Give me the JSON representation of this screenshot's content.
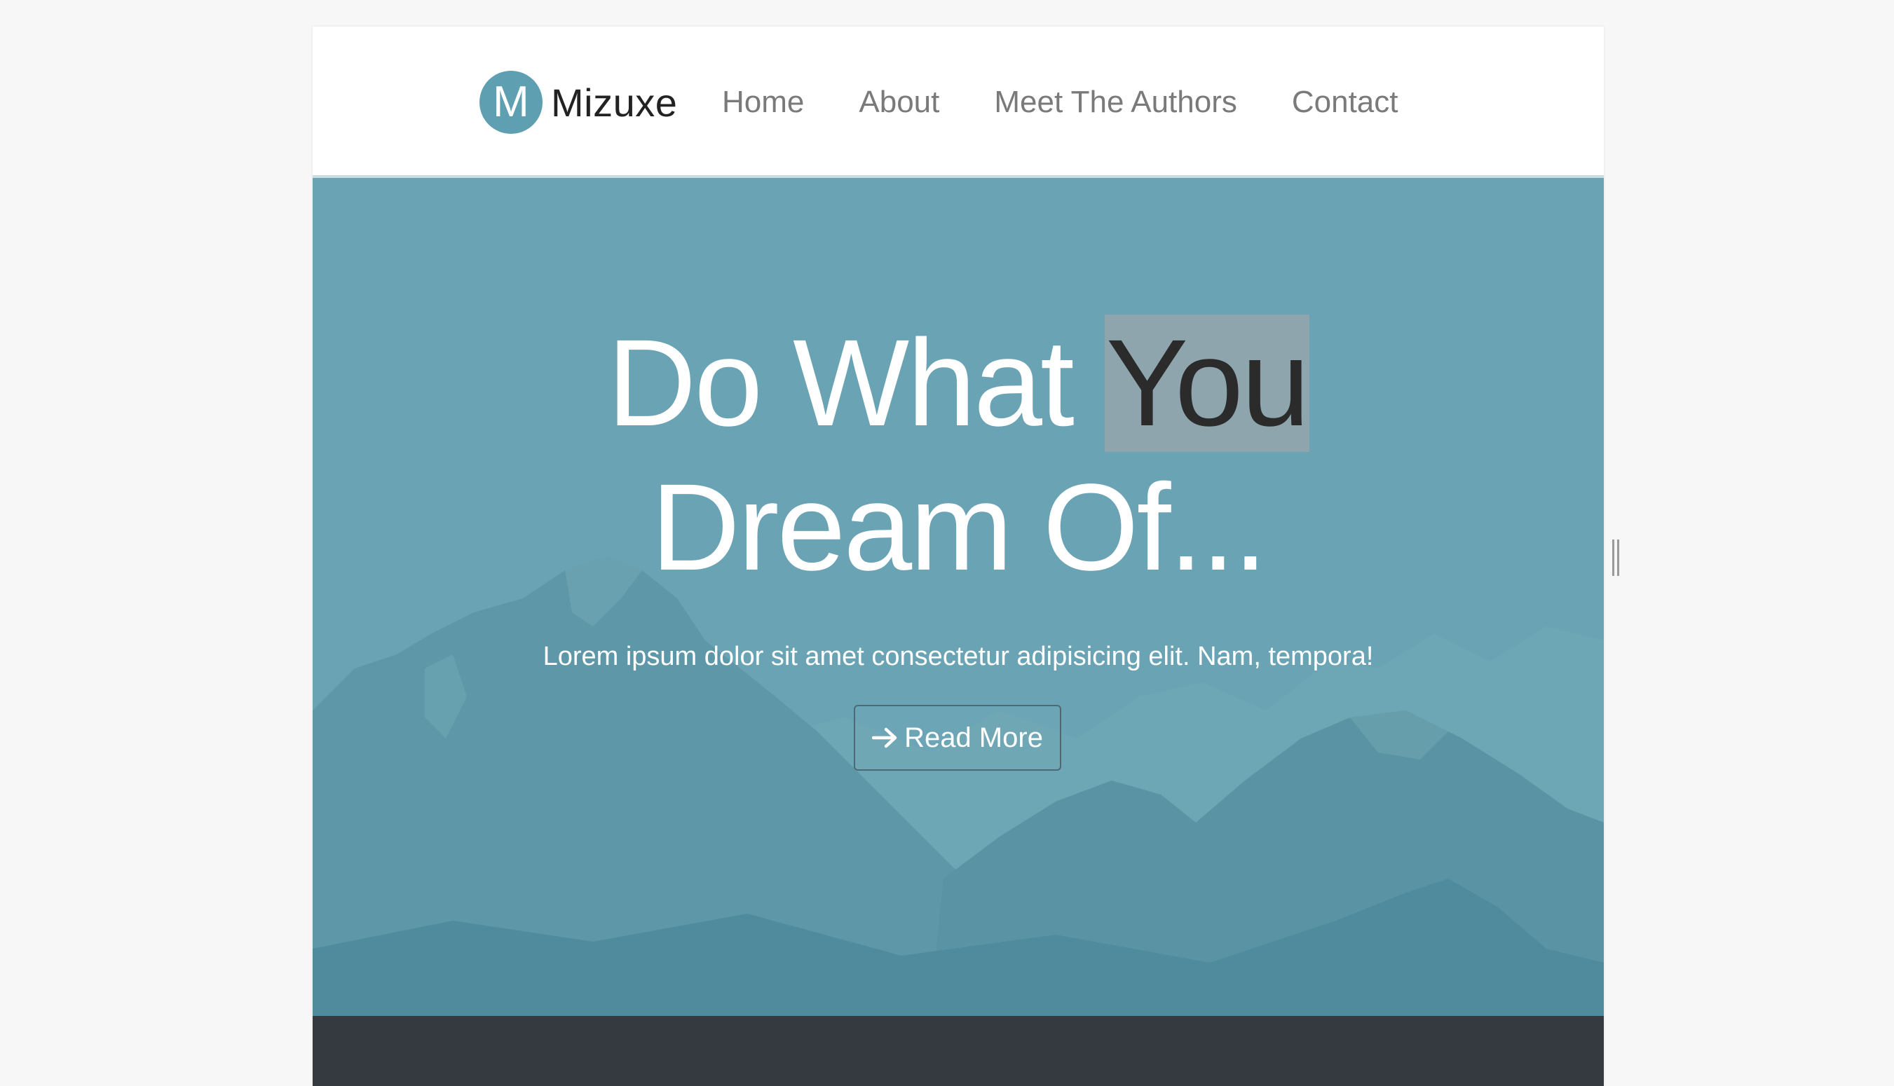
{
  "brand": {
    "logo_letter": "M",
    "name": "Mizuxe"
  },
  "nav": {
    "links": [
      "Home",
      "About",
      "Meet The Authors",
      "Contact"
    ]
  },
  "hero": {
    "title_part1": "Do What ",
    "title_highlight": "You",
    "title_line2": "Dream Of...",
    "subtitle": "Lorem ipsum dolor sit amet consectetur adipisicing elit. Nam, tempora!",
    "button_label": "Read More",
    "button_icon": "arrow-right-icon"
  },
  "colors": {
    "accent": "#5e9fb2",
    "hero_bg": "#6aa4b4",
    "dark_section": "#343a40",
    "highlight": "#8ea5ae"
  }
}
